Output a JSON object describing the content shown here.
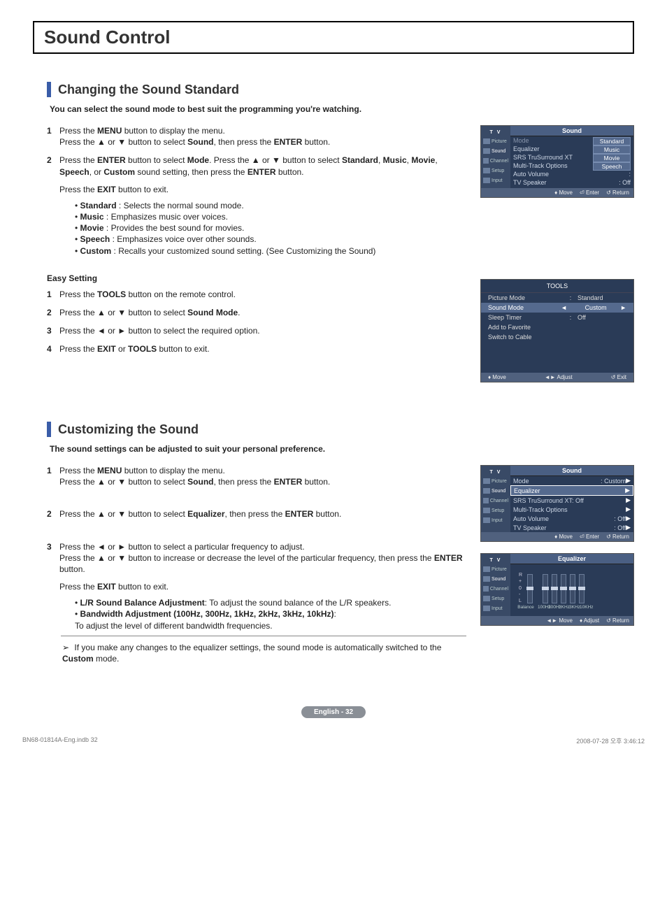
{
  "chapter_title": "Sound Control",
  "section1": {
    "title": "Changing the Sound Standard",
    "desc": "You can select the sound mode to best suit the programming you're watching.",
    "steps": [
      {
        "n": "1",
        "text": "Press the <b>MENU</b> button to display the menu.<br>Press the ▲ or ▼ button to select <b>Sound</b>, then press the <b>ENTER</b> button."
      },
      {
        "n": "2",
        "text": "Press the <b>ENTER</b> button to select <b>Mode</b>. Press the ▲ or ▼ button to select <b>Standard</b>, <b>Music</b>, <b>Movie</b>, <b>Speech</b>, or <b>Custom</b> sound setting, then press the <b>ENTER</b> button."
      }
    ],
    "exit_line": "Press the <b>EXIT</b> button to exit.",
    "bullets": [
      "<b>Standard</b> : Selects the normal sound mode.",
      "<b>Music</b> : Emphasizes music over voices.",
      "<b>Movie</b> : Provides the best sound for movies.",
      "<b>Speech</b> : Emphasizes voice over other sounds.",
      "<b>Custom</b> : Recalls your customized sound setting. (See Customizing the Sound)"
    ],
    "easy_title": "Easy Setting",
    "easy_steps": [
      {
        "n": "1",
        "text": "Press the <b>TOOLS</b> button on the remote control."
      },
      {
        "n": "2",
        "text": "Press the ▲ or ▼ button to select <b>Sound Mode</b>."
      },
      {
        "n": "3",
        "text": "Press the ◄ or ► button to select the required option."
      },
      {
        "n": "4",
        "text": "Press the <b>EXIT</b> or <b>TOOLS</b> button to exit."
      }
    ]
  },
  "osd1": {
    "side_title": "T V",
    "side_items": [
      "Picture",
      "Sound",
      "Channel",
      "Setup",
      "Input"
    ],
    "title": "Sound",
    "rows": [
      {
        "label": "Mode",
        "muted": true,
        "options": [
          "Standard",
          "Music",
          "Movie",
          "Speech"
        ]
      },
      {
        "label": "Equalizer"
      },
      {
        "label": "SRS TruSurround XT",
        "val": ":"
      },
      {
        "label": "Multi-Track Options"
      },
      {
        "label": "Auto Volume",
        "val": ":"
      },
      {
        "label": "TV Speaker",
        "val": ": Off"
      }
    ],
    "footer": [
      "♦ Move",
      "⏎ Enter",
      "↺ Return"
    ]
  },
  "tools": {
    "title": "TOOLS",
    "rows": [
      {
        "l": "Picture Mode",
        "c": ":",
        "r": "Standard"
      },
      {
        "l": "Sound Mode",
        "c": "◄",
        "r": "Custom",
        "r2": "►",
        "hl": true
      },
      {
        "l": "Sleep Timer",
        "c": ":",
        "r": "Off"
      },
      {
        "l": "Add to Favorite",
        "c": "",
        "r": ""
      },
      {
        "l": "Switch to Cable",
        "c": "",
        "r": ""
      }
    ],
    "footer": [
      "♦ Move",
      "◄► Adjust",
      "↺ Exit"
    ]
  },
  "section2": {
    "title": "Customizing the Sound",
    "desc": "The sound settings can be adjusted to suit your personal preference.",
    "steps": [
      {
        "n": "1",
        "text": "Press the <b>MENU</b> button to display the menu.<br>Press the ▲ or ▼ button to select <b>Sound</b>, then press the <b>ENTER</b> button."
      },
      {
        "n": "2",
        "text": "Press the ▲ or ▼ button to select <b>Equalizer</b>, then press the <b>ENTER</b> button."
      },
      {
        "n": "3",
        "text": "Press the ◄ or ► button to select a particular frequency to adjust.<br>Press the ▲ or ▼ button to increase or decrease the level of the particular frequency, then press the <b>ENTER</b> button."
      }
    ],
    "exit_line": "Press the <b>EXIT</b> button to exit.",
    "bullets": [
      "<b>L/R Sound Balance Adjustment</b>: To adjust the sound balance of the L/R speakers.",
      "<b>Bandwidth Adjustment (100Hz, 300Hz, 1kHz, 2kHz, 3kHz, 10kHz)</b>:<br>To adjust the level of different bandwidth frequencies."
    ],
    "note": "If you make any changes to the equalizer settings, the sound mode is automatically switched to the <b>Custom</b> mode."
  },
  "osd2": {
    "side_title": "T V",
    "side_items": [
      "Picture",
      "Sound",
      "Channel",
      "Setup",
      "Input"
    ],
    "title": "Sound",
    "rows": [
      {
        "label": "Mode",
        "val": ": Custom",
        "arrow": true
      },
      {
        "label": "Equalizer",
        "hl": true,
        "arrow": true
      },
      {
        "label": "SRS TruSurround XT: Off",
        "arrow": true
      },
      {
        "label": "Multi-Track Options",
        "arrow": true
      },
      {
        "label": "Auto Volume",
        "val": ": Off",
        "arrow": true
      },
      {
        "label": "TV Speaker",
        "val": ": Off",
        "arrow": true
      }
    ],
    "footer": [
      "♦ Move",
      "⏎ Enter",
      "↺ Return"
    ]
  },
  "osd3": {
    "side_title": "T V",
    "side_items": [
      "Picture",
      "Sound",
      "Channel",
      "Setup",
      "Input"
    ],
    "title": "Equalizer",
    "axis": [
      "R",
      "+",
      "0",
      "-",
      "L"
    ],
    "freq": [
      "Balance",
      "100Hz",
      "300Hz",
      "1KHz",
      "3KHz",
      "10KHz"
    ],
    "footer": [
      "◄► Move",
      "♦ Adjust",
      "↺ Return"
    ]
  },
  "page_footer": "English - 32",
  "doc_meta_left": "BN68-01814A-Eng.indb   32",
  "doc_meta_right": "2008-07-28   오후 3:46:12"
}
